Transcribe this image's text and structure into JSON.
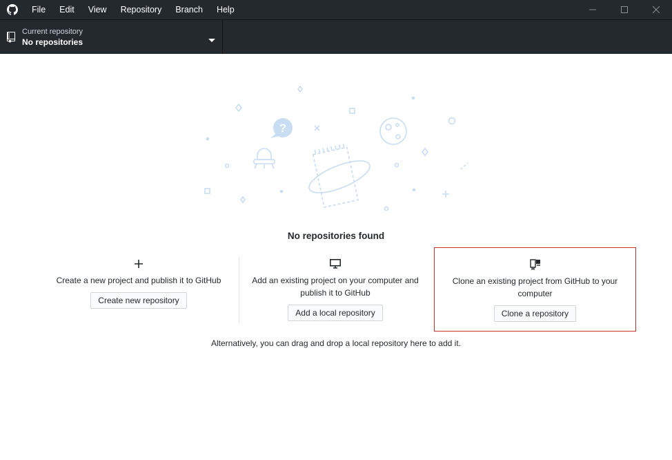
{
  "titlebar": {
    "menu": [
      "File",
      "Edit",
      "View",
      "Repository",
      "Branch",
      "Help"
    ]
  },
  "toolbar": {
    "repo_label": "Current repository",
    "repo_value": "No repositories"
  },
  "main": {
    "title": "No repositories found",
    "create": {
      "text": "Create a new project and publish it to GitHub",
      "button": "Create new repository"
    },
    "add": {
      "text": "Add an existing project on your computer and publish it to GitHub",
      "button": "Add a local repository"
    },
    "clone": {
      "text": "Clone an existing project from GitHub to your computer",
      "button": "Clone a repository"
    },
    "footer": "Alternatively, you can drag and drop a local repository here to add it."
  },
  "colors": {
    "chrome": "#24292e",
    "illustration": "#c8ddf2",
    "highlight_border": "#c9302c"
  }
}
